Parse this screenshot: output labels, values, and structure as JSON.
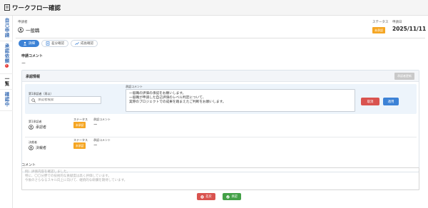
{
  "app": {
    "title": "ワークフロー確認"
  },
  "sidebar": {
    "items": [
      {
        "label": "自己申請"
      },
      {
        "label": "承認依頼",
        "badge": "1"
      },
      {
        "label": "一覧"
      },
      {
        "label": "確認中"
      }
    ]
  },
  "header": {
    "applicant_label": "申請者",
    "applicant_name": "一般職",
    "status_label": "ステータス",
    "status_value": "未承認",
    "date_label": "申請日",
    "date_value": "2025/11/11"
  },
  "tabs": [
    {
      "label": "詳細",
      "icon": "person-icon"
    },
    {
      "label": "差分確認",
      "icon": "document-icon"
    },
    {
      "label": "成長確認",
      "icon": "trend-icon"
    }
  ],
  "application_comment": {
    "label": "申請コメント",
    "value": "ー"
  },
  "approval": {
    "title": "承認情報",
    "reset_label": "承認者更新",
    "edit": {
      "approver_label": "第1承認者（再以）",
      "search_placeholder": "承認者検索",
      "comment_label": "承認コメント",
      "comment_lines": [
        "一般職の評価の承認をお願いします。",
        "一般職が申請した自己評価のレベル判定について、",
        "実際のプロジェクトでの成果を踏まえたご判断をお願いします。"
      ],
      "cancel_label": "取消",
      "apply_label": "適用"
    },
    "reviewers": [
      {
        "role_label": "第1承認者",
        "name": "承認者",
        "status_label": "ステータス",
        "status": "未承認",
        "comment_label": "承認コメント",
        "comment": "ー"
      },
      {
        "role_label": "決裁者",
        "name": "決裁者",
        "status_label": "ステータス",
        "status": "未承認",
        "comment_label": "承認コメント",
        "comment": "ー"
      }
    ]
  },
  "comment": {
    "label": "コメント",
    "placeholder_lines": [
      "例）評価内容を確認しました。",
      "特に、〇〇分野での技術的な貢献度は高く評価しています。",
      "今後のさらなるスキル向上に向けて、継続的な研鑽を期待しています。"
    ]
  },
  "actions": {
    "reject_label": "差戻",
    "approve_label": "承認"
  },
  "colors": {
    "accent": "#3c82d6",
    "warning": "#f5a623",
    "danger": "#d9534f",
    "success": "#43a047"
  }
}
